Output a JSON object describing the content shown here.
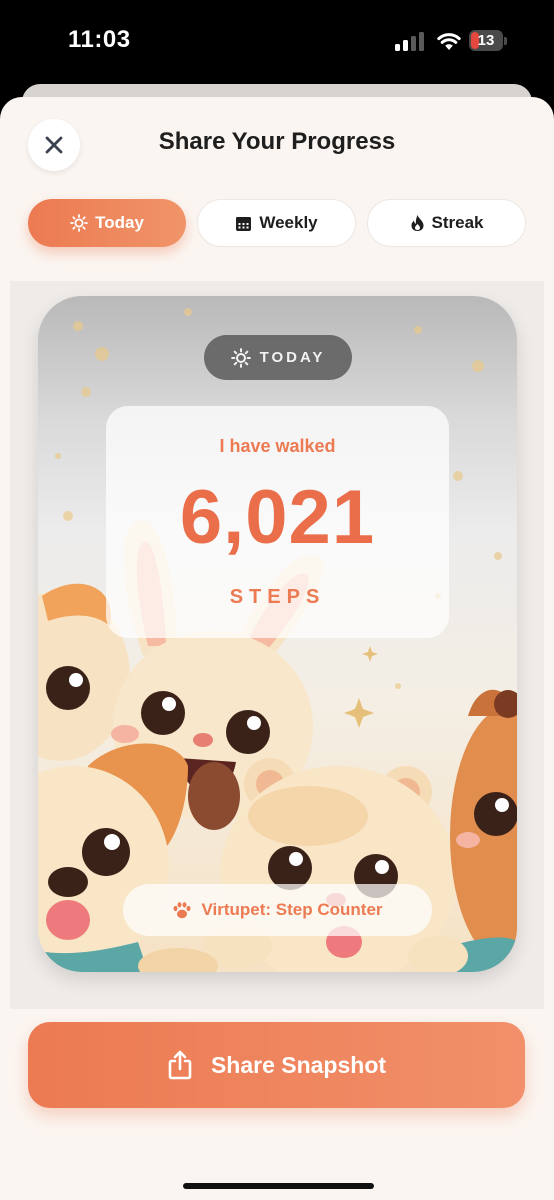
{
  "status_bar": {
    "time": "11:03",
    "battery_level": "13"
  },
  "header": {
    "title": "Share Your Progress",
    "close_icon": "close-icon"
  },
  "tabs": [
    {
      "label": "Today",
      "icon": "sun-icon",
      "selected": true
    },
    {
      "label": "Weekly",
      "icon": "calendar-icon",
      "selected": false
    },
    {
      "label": "Streak",
      "icon": "flame-icon",
      "selected": false
    }
  ],
  "snapshot": {
    "badge_label": "TODAY",
    "badge_icon": "sun-icon",
    "walked_text": "I have walked",
    "step_count": "6,021",
    "step_unit": "STEPS",
    "app_label": "Virtupet: Step Counter",
    "app_icon": "paw-icon"
  },
  "share_button": {
    "label": "Share Snapshot",
    "icon": "share-icon"
  },
  "colors": {
    "accent": "#EC7A52",
    "sheet_bg": "#FBF5F1",
    "text_dark": "#1E1E1E"
  }
}
